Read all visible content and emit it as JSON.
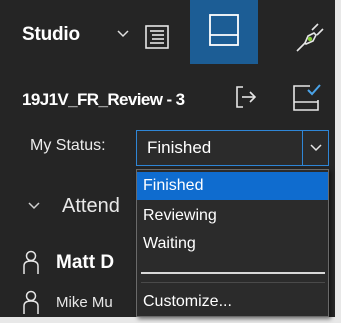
{
  "header": {
    "workspace_label": "Studio",
    "icons": {
      "chevron": "chevron-down-icon",
      "notes": "notes-icon",
      "panel": "panel-icon",
      "plug": "plug-icon"
    }
  },
  "session": {
    "name": "19J1V_FR_Review - 3",
    "icons": {
      "exit": "exit-session-icon",
      "checklist": "checklist-icon"
    }
  },
  "status": {
    "label": "My Status:",
    "selected": "Finished",
    "options": [
      "Finished",
      "Reviewing",
      "Waiting",
      "",
      "Customize..."
    ]
  },
  "attendees": {
    "label": "Attend",
    "people": [
      {
        "name": "Matt D"
      },
      {
        "name": "Mike Mu"
      }
    ]
  },
  "colors": {
    "accent": "#1c5d95",
    "selection": "#0f6ccf",
    "border_focus": "#2f86d6",
    "plug_green": "#7ec832",
    "check_blue": "#4aa3e8"
  }
}
